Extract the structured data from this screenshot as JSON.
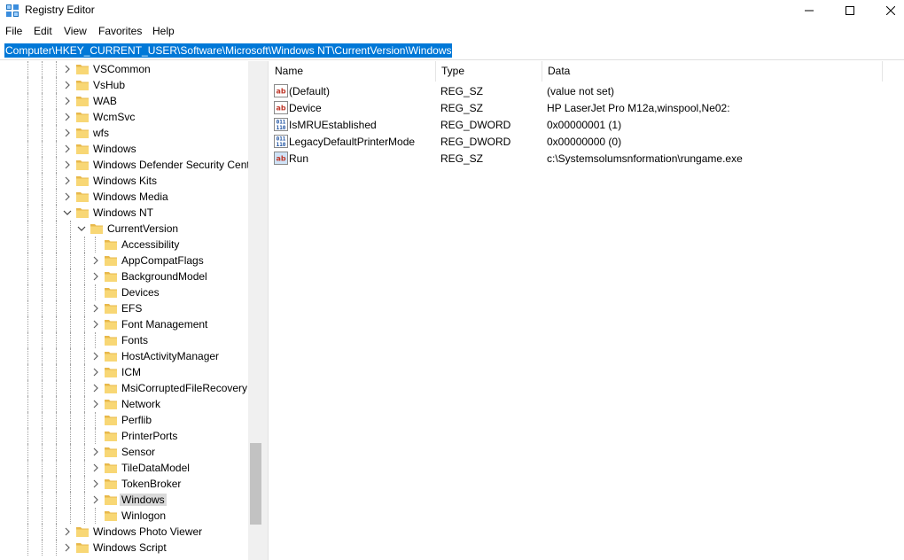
{
  "window": {
    "title": "Registry Editor"
  },
  "menu": [
    "File",
    "Edit",
    "View",
    "Favorites",
    "Help"
  ],
  "address": "Computer\\HKEY_CURRENT_USER\\Software\\Microsoft\\Windows NT\\CurrentVersion\\Windows",
  "tree": [
    {
      "label": "VSCommon",
      "level": 0,
      "expand": "collapsed"
    },
    {
      "label": "VsHub",
      "level": 0,
      "expand": "collapsed"
    },
    {
      "label": "WAB",
      "level": 0,
      "expand": "collapsed"
    },
    {
      "label": "WcmSvc",
      "level": 0,
      "expand": "collapsed"
    },
    {
      "label": "wfs",
      "level": 0,
      "expand": "collapsed"
    },
    {
      "label": "Windows",
      "level": 0,
      "expand": "collapsed"
    },
    {
      "label": "Windows Defender Security Cent",
      "level": 0,
      "expand": "collapsed"
    },
    {
      "label": "Windows Kits",
      "level": 0,
      "expand": "collapsed"
    },
    {
      "label": "Windows Media",
      "level": 0,
      "expand": "collapsed"
    },
    {
      "label": "Windows NT",
      "level": 0,
      "expand": "expanded"
    },
    {
      "label": "CurrentVersion",
      "level": 1,
      "expand": "expanded"
    },
    {
      "label": "Accessibility",
      "level": 2,
      "expand": "none"
    },
    {
      "label": "AppCompatFlags",
      "level": 2,
      "expand": "collapsed"
    },
    {
      "label": "BackgroundModel",
      "level": 2,
      "expand": "collapsed"
    },
    {
      "label": "Devices",
      "level": 2,
      "expand": "none"
    },
    {
      "label": "EFS",
      "level": 2,
      "expand": "collapsed"
    },
    {
      "label": "Font Management",
      "level": 2,
      "expand": "collapsed"
    },
    {
      "label": "Fonts",
      "level": 2,
      "expand": "none"
    },
    {
      "label": "HostActivityManager",
      "level": 2,
      "expand": "collapsed"
    },
    {
      "label": "ICM",
      "level": 2,
      "expand": "collapsed"
    },
    {
      "label": "MsiCorruptedFileRecovery",
      "level": 2,
      "expand": "collapsed"
    },
    {
      "label": "Network",
      "level": 2,
      "expand": "collapsed"
    },
    {
      "label": "Perflib",
      "level": 2,
      "expand": "none"
    },
    {
      "label": "PrinterPorts",
      "level": 2,
      "expand": "none"
    },
    {
      "label": "Sensor",
      "level": 2,
      "expand": "collapsed"
    },
    {
      "label": "TileDataModel",
      "level": 2,
      "expand": "collapsed"
    },
    {
      "label": "TokenBroker",
      "level": 2,
      "expand": "collapsed"
    },
    {
      "label": "Windows",
      "level": 2,
      "expand": "collapsed",
      "selected": true
    },
    {
      "label": "Winlogon",
      "level": 2,
      "expand": "none"
    },
    {
      "label": "Windows Photo Viewer",
      "level": 0,
      "expand": "collapsed"
    },
    {
      "label": "Windows Script",
      "level": 0,
      "expand": "collapsed"
    }
  ],
  "columns": {
    "name": "Name",
    "type": "Type",
    "data": "Data"
  },
  "values": [
    {
      "icon": "string-value-icon",
      "name": "(Default)",
      "type": "REG_SZ",
      "data": "(value not set)"
    },
    {
      "icon": "string-value-icon",
      "name": "Device",
      "type": "REG_SZ",
      "data": "HP LaserJet Pro M12a,winspool,Ne02:"
    },
    {
      "icon": "binary-value-icon",
      "name": "IsMRUEstablished",
      "type": "REG_DWORD",
      "data": "0x00000001 (1)"
    },
    {
      "icon": "binary-value-icon",
      "name": "LegacyDefaultPrinterMode",
      "type": "REG_DWORD",
      "data": "0x00000000 (0)"
    },
    {
      "icon": "string-value-icon-selected",
      "name": "Run",
      "type": "REG_SZ",
      "data": "c:\\Systemsolumsnformation\\rungame.exe"
    }
  ],
  "colors": {
    "selection": "#0078d7",
    "tree_selection": "#d9d9d9",
    "folder": "#f8d775"
  }
}
